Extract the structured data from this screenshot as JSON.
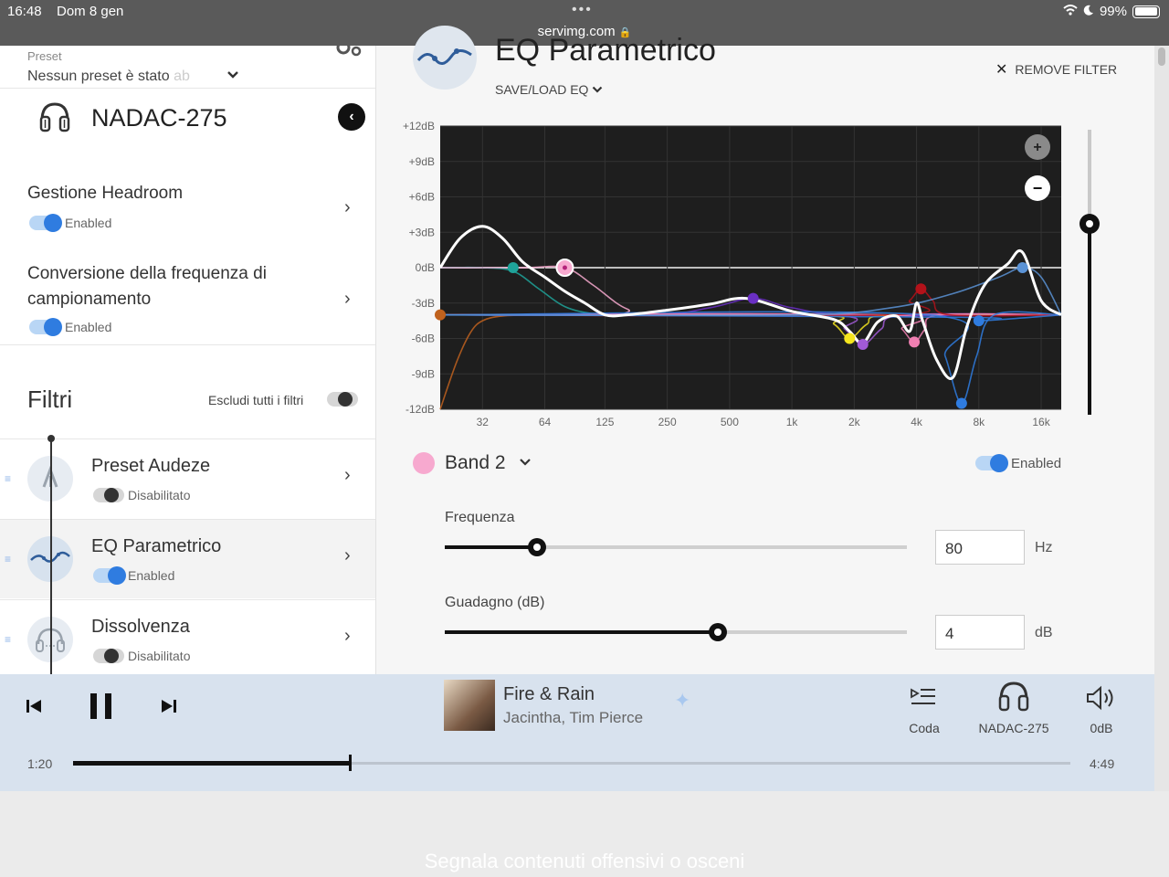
{
  "statusbar": {
    "time": "16:48",
    "date": "Dom 8 gen",
    "dots": "•••",
    "url": "servimg.com",
    "battery": "99%",
    "battery_level": 0.99
  },
  "sidebar": {
    "preset_label": "Preset",
    "preset_value": "Nessun preset è stato",
    "preset_value_faded": "ab",
    "device_name": "NADAC-275",
    "settings": [
      {
        "title": "Gestione Headroom",
        "toggle_label": "Enabled",
        "on": true
      },
      {
        "title": "Conversione della frequenza di campionamento",
        "toggle_label": "Enabled",
        "on": true
      }
    ],
    "filters_title": "Filtri",
    "exclude_all": "Escludi tutti i filtri",
    "filters": [
      {
        "name": "Preset Audeze",
        "toggle_label": "Disabilitato",
        "on": false
      },
      {
        "name": "EQ Parametrico",
        "toggle_label": "Enabled",
        "on": true
      },
      {
        "name": "Dissolvenza",
        "toggle_label": "Disabilitato",
        "on": false
      }
    ]
  },
  "main": {
    "title": "EQ Parametrico",
    "save_load": "SAVE/LOAD EQ",
    "remove_filter": "REMOVE FILTER",
    "band": {
      "label": "Band 2",
      "enabled_label": "Enabled",
      "color": "#f7a9cf",
      "frequency_label": "Frequenza",
      "frequency_value": "80",
      "frequency_unit": "Hz",
      "frequency_fraction": 0.2,
      "gain_label": "Guadagno (dB)",
      "gain_value": "4",
      "gain_unit": "dB",
      "gain_fraction": 0.59
    },
    "output_level_fraction": 0.33
  },
  "chart_data": {
    "type": "line",
    "title": "",
    "xlabel": "",
    "ylabel": "",
    "x_scale": "log",
    "x_ticks": [
      32,
      64,
      125,
      250,
      500,
      1000,
      2000,
      4000,
      8000,
      16000
    ],
    "x_tick_labels": [
      "32",
      "64",
      "125",
      "250",
      "500",
      "1k",
      "2k",
      "4k",
      "8k",
      "16k"
    ],
    "xlim": [
      20,
      20000
    ],
    "y_ticks": [
      12,
      9,
      6,
      3,
      0,
      -3,
      -6,
      -9,
      -12
    ],
    "y_tick_labels": [
      "+12dB",
      "+9dB",
      "+6dB",
      "+3dB",
      "0dB",
      "-3dB",
      "-6dB",
      "-9dB",
      "-12dB"
    ],
    "ylim": [
      -12,
      12
    ],
    "grid": true,
    "background": "#1e1e1e",
    "zoom_in": "+",
    "zoom_out": "−",
    "total_response": {
      "color": "#ffffff",
      "x": [
        20,
        25,
        32,
        40,
        50,
        64,
        80,
        100,
        125,
        160,
        250,
        400,
        600,
        1000,
        1600,
        1900,
        2200,
        2600,
        3200,
        3700,
        4000,
        4300,
        5000,
        6000,
        7000,
        8500,
        11000,
        13000,
        16000,
        20000
      ],
      "y": [
        0.0,
        2.5,
        3.5,
        2.5,
        0.5,
        -0.8,
        -2.0,
        -3.0,
        -4.0,
        -4.0,
        -3.6,
        -3.1,
        -2.6,
        -3.7,
        -4.4,
        -5.4,
        -6.4,
        -4.6,
        -4.1,
        -5.4,
        -3.0,
        -4.6,
        -7.8,
        -9.3,
        -5.0,
        -1.5,
        0.3,
        1.3,
        -2.8,
        -4.0
      ]
    },
    "bands": [
      {
        "color": "#c0621e",
        "freq": 20,
        "gain": -4.0,
        "curve_x": [
          20,
          24,
          28,
          32,
          40,
          60,
          100,
          20000
        ],
        "curve_y": [
          -12,
          -8,
          -5.5,
          -4.5,
          -4.1,
          -4.0,
          -4.0,
          -4.0
        ]
      },
      {
        "color": "#1fa39a",
        "freq": 45,
        "gain": 0.0,
        "curve_x": [
          20,
          32,
          45,
          60,
          80,
          110,
          160,
          250,
          20000
        ],
        "curve_y": [
          0,
          0,
          -0.3,
          -1.8,
          -3.3,
          -3.9,
          -4.0,
          -4.0,
          -4.0
        ]
      },
      {
        "color": "#f7a9cf",
        "freq": 80,
        "gain": 0.0,
        "curve_x": [
          20,
          50,
          80,
          110,
          160,
          250,
          20000
        ],
        "curve_y": [
          0,
          0,
          0,
          -1.5,
          -3.5,
          -4.0,
          -4.0
        ]
      },
      {
        "color": "#6a2fc4",
        "freq": 650,
        "gain": -2.6,
        "curve_x": [
          20,
          200,
          400,
          650,
          1000,
          2000,
          20000
        ],
        "curve_y": [
          -4,
          -4,
          -3.4,
          -2.6,
          -3.4,
          -4.0,
          -4.0
        ]
      },
      {
        "color": "#f5e51e",
        "freq": 1900,
        "gain": -6.0,
        "curve_x": [
          20,
          1200,
          1600,
          1900,
          2300,
          3000,
          20000
        ],
        "curve_y": [
          -4,
          -4,
          -4.8,
          -6.0,
          -4.8,
          -4.0,
          -4.0
        ]
      },
      {
        "color": "#a15ad6",
        "freq": 2200,
        "gain": -6.5,
        "curve_x": [
          20,
          1400,
          1800,
          2200,
          2700,
          3500,
          20000
        ],
        "curve_y": [
          -4,
          -4,
          -5.2,
          -6.5,
          -5.2,
          -4.0,
          -4.0
        ]
      },
      {
        "color": "#f07fb1",
        "freq": 3900,
        "gain": -6.3,
        "curve_x": [
          20,
          2800,
          3400,
          3900,
          4400,
          5200,
          20000
        ],
        "curve_y": [
          -4,
          -4,
          -5.2,
          -6.3,
          -5.2,
          -4.0,
          -4.0
        ]
      },
      {
        "color": "#b3121a",
        "freq": 4200,
        "gain": -1.8,
        "curve_x": [
          20,
          3000,
          3700,
          4200,
          4800,
          5800,
          20000
        ],
        "curve_y": [
          -4,
          -4,
          -2.8,
          -1.8,
          -2.8,
          -4.0,
          -4.0
        ]
      },
      {
        "color": "#2f7ce0",
        "freq": 6600,
        "gain": -11.5,
        "curve_x": [
          20,
          4500,
          5500,
          6600,
          7800,
          9500,
          20000
        ],
        "curve_y": [
          -4,
          -4,
          -7.5,
          -11.5,
          -7.5,
          -4.0,
          -4.0
        ]
      },
      {
        "color": "#2f7ce0",
        "freq": 8000,
        "gain": -4.5,
        "curve_x": [
          20,
          6500,
          8000,
          20000
        ],
        "curve_y": [
          -4,
          -4.2,
          -4.5,
          -4.0
        ]
      },
      {
        "color": "#5b93d6",
        "freq": 13000,
        "gain": 0.0,
        "curve_x": [
          20,
          1000,
          3000,
          6000,
          10000,
          13000,
          16000,
          20000
        ],
        "curve_y": [
          -4,
          -4,
          -3.4,
          -2.2,
          -0.8,
          0.0,
          -0.8,
          -4.0
        ]
      }
    ]
  },
  "player": {
    "track_title": "Fire & Rain",
    "track_artist": "Jacintha, Tim Pierce",
    "queue_label": "Coda",
    "device_label": "NADAC-275",
    "volume_label": "0dB",
    "elapsed": "1:20",
    "duration": "4:49",
    "progress_fraction": 0.277
  },
  "banner": "Segnala contenuti offensivi o osceni"
}
